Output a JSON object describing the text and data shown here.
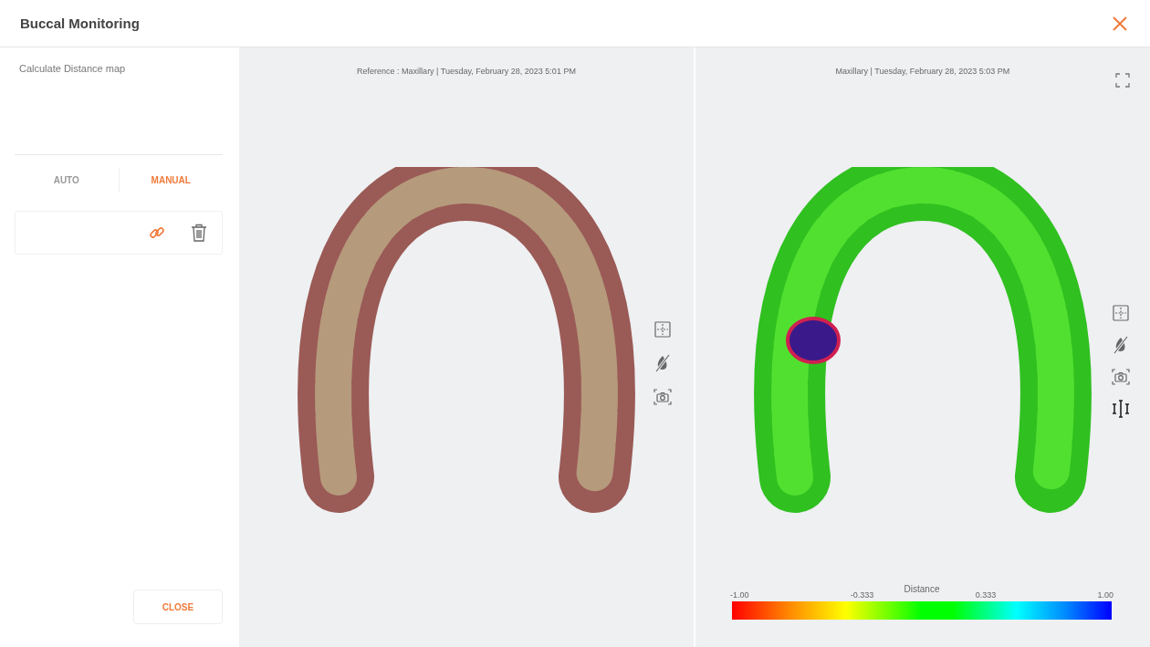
{
  "header": {
    "title": "Buccal Monitoring"
  },
  "sidebar": {
    "heading": "Calculate Distance map",
    "tabs": [
      {
        "label": "AUTO",
        "selected": false
      },
      {
        "label": "MANUAL",
        "selected": true
      }
    ],
    "close_button": "CLOSE"
  },
  "viewports": [
    {
      "caption": "Reference : Maxillary | Tuesday, February 28, 2023 5:01 PM",
      "kind": "scan",
      "tools": [
        {
          "kind": "grid"
        },
        {
          "kind": "hide"
        },
        {
          "kind": "camera"
        }
      ]
    },
    {
      "caption": "Maxillary | Tuesday, February 28, 2023 5:03 PM",
      "kind": "distance",
      "tools": [
        {
          "kind": "grid"
        },
        {
          "kind": "hide"
        },
        {
          "kind": "camera"
        },
        {
          "kind": "measure"
        }
      ]
    }
  ],
  "legend": {
    "title": "Distance",
    "ticks": [
      "-1.00",
      "-0.333",
      "0.333",
      "1.00"
    ]
  }
}
